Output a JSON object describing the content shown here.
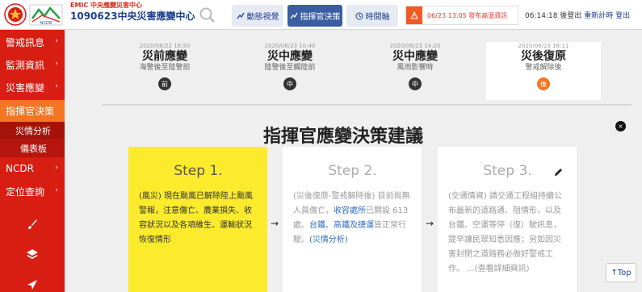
{
  "header": {
    "brand_sub": "EMIC 中央應變災害中心",
    "brand_title": "1090623中央災害應變中心",
    "tabs": [
      {
        "icon": "chart-line-icon",
        "label": "動態視覺"
      },
      {
        "icon": "chart-line-icon",
        "label": "指揮官決策"
      },
      {
        "icon": "clock-icon",
        "label": "時間軸"
      }
    ],
    "alert": {
      "icon": "warning-icon",
      "text": "06/23 13:05 發布高溫資訊"
    },
    "time": "06:14:18",
    "status_update": "後登出",
    "refresh_label": "重新計時",
    "logout_label": "登出"
  },
  "sidebar": {
    "items": [
      {
        "label": "警戒訊息"
      },
      {
        "label": "監測資訊"
      },
      {
        "label": "災害應變"
      },
      {
        "label": "指揮官決策"
      }
    ],
    "subitems": [
      {
        "label": "災情分析"
      },
      {
        "label": "儀表板"
      }
    ],
    "items2": [
      {
        "label": "NCDR"
      },
      {
        "label": "定位查詢"
      }
    ],
    "chevron": "›"
  },
  "timeline": [
    {
      "date": "2020/06/22 16:50",
      "name": "災前應變",
      "desc": "海警後至陸警前",
      "badge": "前"
    },
    {
      "date": "2020/06/23 10:40",
      "name": "災中應變",
      "desc": "陸警後至觸陸前",
      "badge": "中"
    },
    {
      "date": "2020/06/23 14:20",
      "name": "災中應變",
      "desc": "風雨影響時",
      "badge": "中"
    },
    {
      "date": "2020/06/23 16:11",
      "name": "災後復原",
      "desc": "警戒解除後",
      "badge": "後"
    }
  ],
  "main": {
    "title": "指揮官應變決策建議",
    "close_glyph": "×",
    "steps": [
      {
        "label": "Step 1.",
        "text": "(風災) 現在颱風已解除陸上颱風警報，注意傷亡、農業損失、收容狀況以及各項維生、運輸狀況恢復情形"
      },
      {
        "label": "Step 2.",
        "text_a": "(災後復原-警戒解除後) 目前尚無人員傷亡，",
        "link_a": "收容處所",
        "text_b": "已開設 613處。",
        "link_b": "台鐵、高鐵及捷運",
        "text_c": "皆正常行駛。",
        "link_c": "(災情分析)"
      },
      {
        "label": "Step 3.",
        "text": "(交通情資) 請交通工程組持續公布最新的道路通、阻情形，以及台鐵、空運等停（復）駛訊息，提早讓民眾知悉因應；另如因災害封閉之道路務必做好警戒工作。 ...(查看詳細資訊)"
      }
    ],
    "arrow_glyph": "→",
    "top_label": "Top",
    "top_glyph": "↑"
  }
}
